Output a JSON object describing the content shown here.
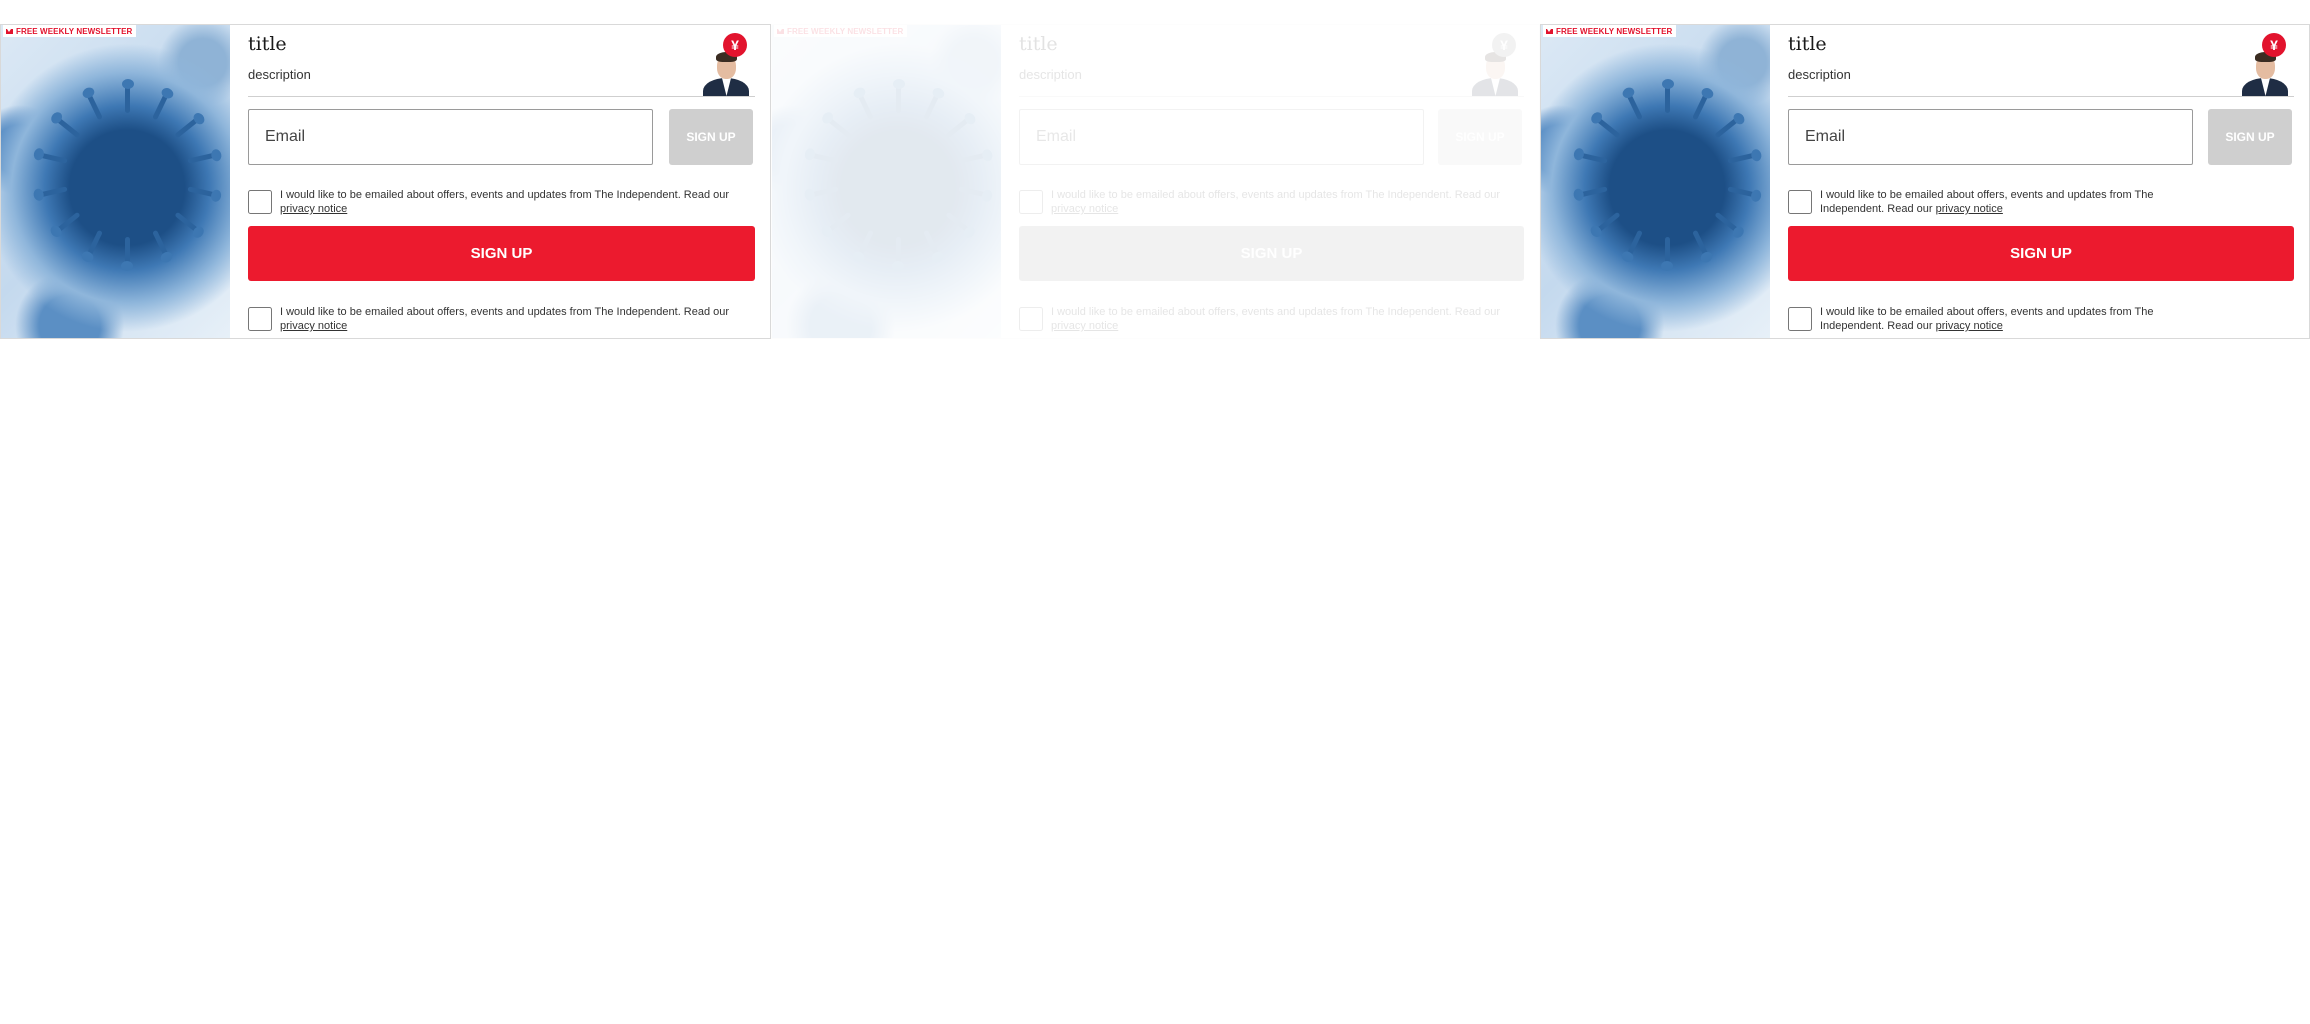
{
  "newsletter": {
    "badge": "Free weekly newsletter",
    "title": "title",
    "description": "description",
    "email_placeholder": "Email",
    "small_button": "Sign up",
    "consent_text": "I would like to be emailed about offers, events and updates from The Independent. Read our ",
    "privacy_link": "privacy notice",
    "big_button": "Sign up",
    "logo_glyph": "¥",
    "colors": {
      "accent_red": "#ec1a2e",
      "disabled_gray": "#cfcfcf",
      "hero_blue": "#2c639d"
    },
    "icons": [
      "mail-icon",
      "independent-eagle-logo",
      "author-headshot",
      "virus-hero-image"
    ]
  },
  "variants": [
    {
      "id": "default"
    },
    {
      "id": "faded-overlay"
    },
    {
      "id": "narrow-consent"
    }
  ]
}
